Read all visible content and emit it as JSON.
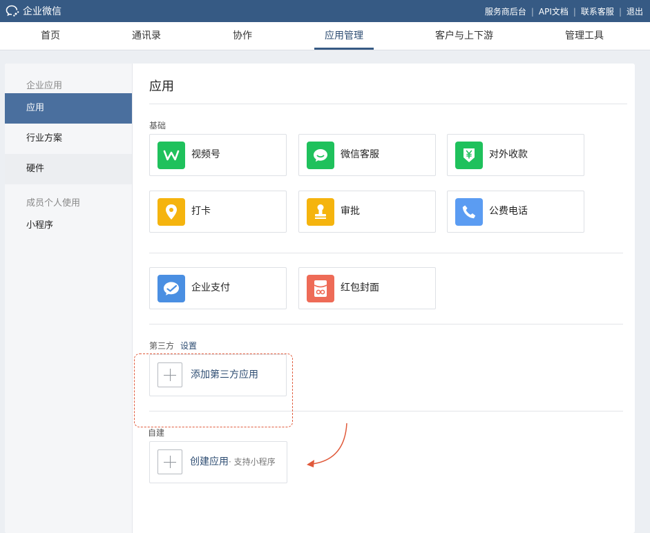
{
  "topbar": {
    "brand": "企业微信",
    "links": [
      "服务商后台",
      "API文档",
      "联系客服",
      "退出"
    ]
  },
  "nav": {
    "tabs": [
      "首页",
      "通讯录",
      "协作",
      "应用管理",
      "客户与上下游",
      "管理工具"
    ],
    "active": "应用管理"
  },
  "sidebar": {
    "group1": "企业应用",
    "items1": [
      "应用",
      "行业方案",
      "硬件"
    ],
    "group2": "成员个人使用",
    "items2": [
      "小程序"
    ]
  },
  "main": {
    "title": "应用",
    "basic_label": "基础",
    "apps_row1": [
      {
        "label": "视频号",
        "icon": "video-channel-icon",
        "color": "#1fc15c"
      },
      {
        "label": "微信客服",
        "icon": "wechat-service-icon",
        "color": "#1fc15c"
      },
      {
        "label": "对外收款",
        "icon": "yuan-shield-icon",
        "color": "#1fc15c"
      }
    ],
    "apps_row2": [
      {
        "label": "打卡",
        "icon": "location-pin-icon",
        "color": "#f5b40e"
      },
      {
        "label": "审批",
        "icon": "stamp-icon",
        "color": "#f5b40e"
      },
      {
        "label": "公费电话",
        "icon": "phone-icon",
        "color": "#5b9cf2"
      }
    ],
    "apps_row3": [
      {
        "label": "企业支付",
        "icon": "enterprise-pay-icon",
        "color": "#4a8fe2"
      },
      {
        "label": "红包封面",
        "icon": "red-packet-icon",
        "color": "#ee6b57"
      }
    ],
    "third_party_label": "第三方",
    "settings_link": "设置",
    "add_third_party": "添加第三方应用",
    "custom_label": "自建",
    "create_app": "创建应用",
    "create_app_sub": "· 支持小程序"
  }
}
